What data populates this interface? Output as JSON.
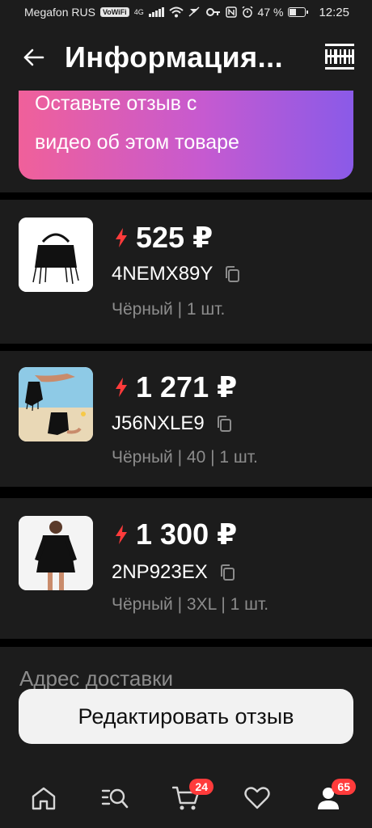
{
  "status_bar": {
    "carrier": "Megafon RUS",
    "volte": "VoWiFi",
    "network": "4G",
    "battery_percent_label": "47 %",
    "battery_level": 0.47,
    "time": "12:25"
  },
  "header": {
    "title": "Информация...",
    "back_icon": "arrow-left-icon",
    "barcode_icon": "barcode-icon"
  },
  "banner": {
    "line1": "Оставьте отзыв с",
    "line2": "видео об этом товаре"
  },
  "items": [
    {
      "price": "525 ₽",
      "sku": "4NEMX89Y",
      "meta": "Чёрный | 1 шт."
    },
    {
      "price": "1 271 ₽",
      "sku": "J56NXLE9",
      "meta": "Чёрный | 40 | 1 шт."
    },
    {
      "price": "1 300 ₽",
      "sku": "2NP923EX",
      "meta": "Чёрный | 3XL | 1 шт."
    }
  ],
  "address": {
    "label": "Адрес доставки"
  },
  "edit_button": {
    "label": "Редактировать отзыв"
  },
  "bottom_nav": {
    "cart_badge": "24",
    "profile_badge": "65"
  },
  "colors": {
    "accent_red": "#ff3b3b",
    "banner_gradient_start": "#f0609a",
    "banner_gradient_end": "#8a5ae8",
    "background": "#1c1c1c"
  }
}
